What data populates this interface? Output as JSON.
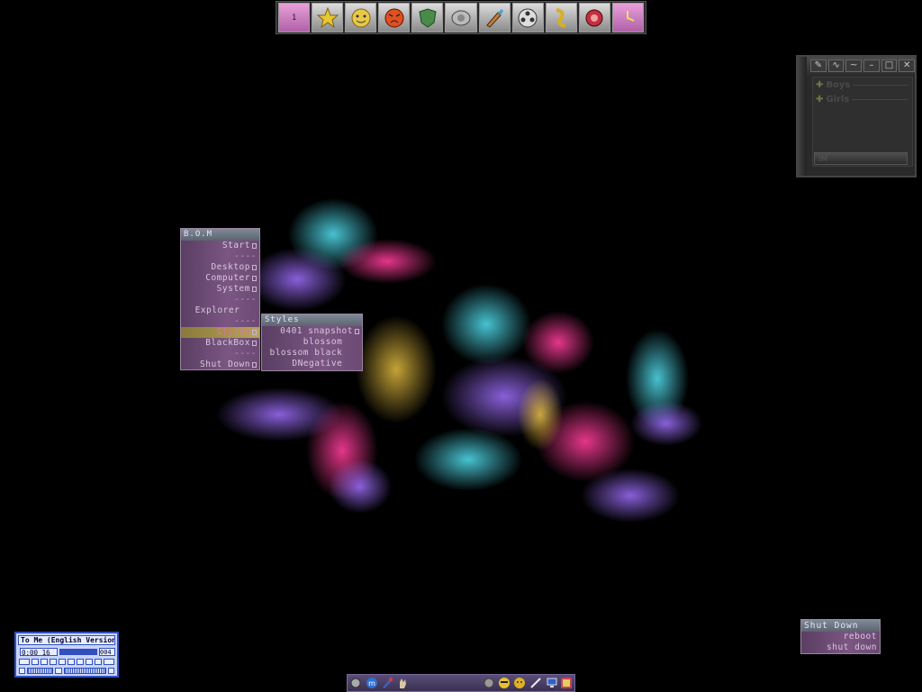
{
  "top_dock": {
    "workspace_number": "1",
    "icons": [
      "workspace-pager-icon",
      "star-icon",
      "smiley-icon",
      "angry-face-icon",
      "shield-icon",
      "drive-icon",
      "brush-icon",
      "film-reel-icon",
      "ribbon-icon",
      "gear-flower-icon",
      "clock-icon"
    ]
  },
  "bom_menu": {
    "title": "B.O.M",
    "items": [
      {
        "label": "Start",
        "submenu": true
      },
      {
        "label": "----",
        "separator": true
      },
      {
        "label": "Desktop",
        "submenu": true
      },
      {
        "label": "Computer",
        "submenu": true
      },
      {
        "label": "System",
        "submenu": true
      },
      {
        "label": "----",
        "separator": true
      },
      {
        "label": "Explorer",
        "submenu": false
      },
      {
        "label": "----",
        "separator": true
      },
      {
        "label": "Styles",
        "submenu": true,
        "selected": true
      },
      {
        "label": "BlackBox",
        "submenu": true
      },
      {
        "label": "----",
        "separator": true
      },
      {
        "label": "Shut Down",
        "submenu": true
      }
    ]
  },
  "styles_menu": {
    "title": "Styles",
    "items": [
      {
        "label": "0401 snapshot",
        "submenu": true
      },
      {
        "label": "blossom",
        "submenu": false
      },
      {
        "label": "blossom black",
        "submenu": false
      },
      {
        "label": "DNegative",
        "submenu": false
      }
    ]
  },
  "im_window": {
    "groups": [
      "Boys",
      "Girls"
    ],
    "status": "IM"
  },
  "shutdown_menu": {
    "title": "Shut Down",
    "items": [
      "reboot",
      "shut down"
    ]
  },
  "player": {
    "title": "To Me (English Version",
    "time": "0:00 16",
    "track": "004",
    "buttons": [
      "LIST",
      "EQ",
      "PREV",
      "PLAY",
      "PAUSE",
      "STOP",
      "NEXT",
      "OPEN",
      "EJECT"
    ]
  },
  "colors": {
    "menu_bg": "#6c4a74",
    "menu_title": "#6f7884",
    "selected": "#b8a45a",
    "player_blue": "#3050c0"
  }
}
